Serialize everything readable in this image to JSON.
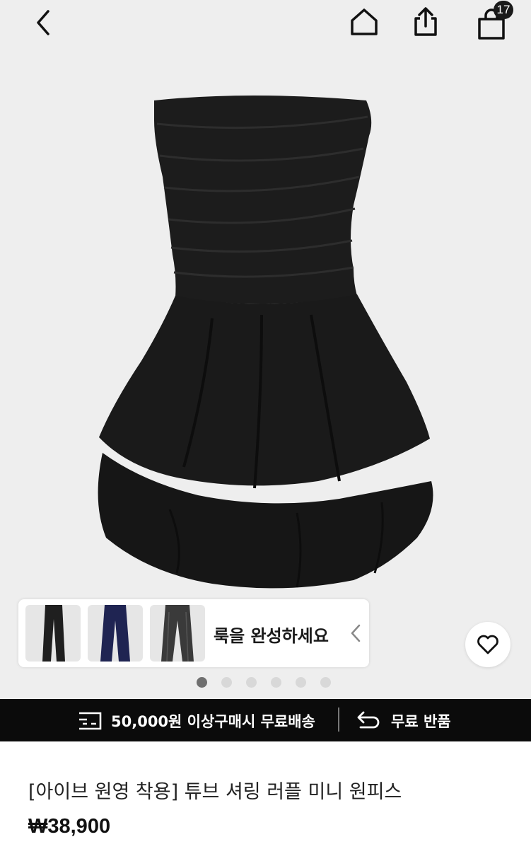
{
  "header": {
    "back_icon": "chevron-left-icon",
    "home_icon": "home-icon",
    "share_icon": "share-icon",
    "cart_icon": "shopping-bag-icon",
    "cart_count": "17"
  },
  "product_image": {
    "icon": "black-strapless-mini-dress",
    "slide_count": 6,
    "active_slide": 1
  },
  "complete_look": {
    "label": "룩을 완성하세요",
    "thumbnails": [
      "black-pants",
      "navy-pants",
      "charcoal-pants"
    ]
  },
  "wishlist": {
    "icon": "heart-icon"
  },
  "info_bar": {
    "shipping_text": "50,000원 이상구매시 무료배송",
    "return_text": "무료 반품"
  },
  "product": {
    "title": "[아이브 원영 착용] 튜브 셔링 러플 미니 원피스",
    "price": "₩38,900"
  },
  "colors": {
    "hero_bg": "#eeeeee",
    "bar_bg": "#0b0b0b",
    "dress": "#1c1c1c"
  }
}
